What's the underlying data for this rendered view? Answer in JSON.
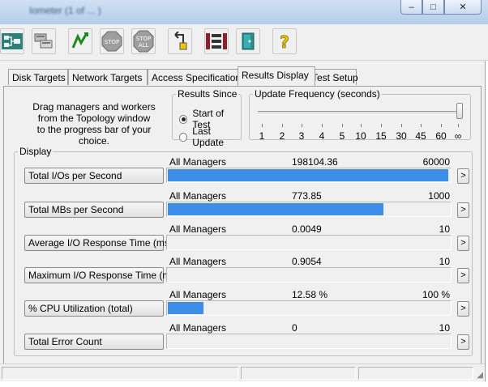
{
  "window": {
    "title": "Iometer (1 of ... )",
    "minimize_glyph": "–",
    "maximize_glyph": "□",
    "close_glyph": "✕"
  },
  "toolbar": {
    "buttons": [
      {
        "icon": "topology-icon"
      },
      {
        "icon": "config-icon"
      },
      {
        "icon": "start-tests-icon"
      },
      {
        "icon": "stop-icon",
        "label": "STOP"
      },
      {
        "icon": "stop-all-icon",
        "label": "STOP ALL"
      },
      {
        "icon": "reset-workers-icon"
      },
      {
        "icon": "new-worker-icon"
      },
      {
        "icon": "exit-icon"
      },
      {
        "icon": "help-icon",
        "label": "?"
      }
    ]
  },
  "tabs": [
    {
      "label": "Disk Targets"
    },
    {
      "label": "Network Targets"
    },
    {
      "label": "Access Specifications"
    },
    {
      "label": "Results Display",
      "active": true
    },
    {
      "label": "Test Setup"
    }
  ],
  "instructions": {
    "line1": "Drag managers and workers",
    "line2": "from the Topology window",
    "line3": "to the progress bar of your choice."
  },
  "results_since": {
    "legend": "Results Since",
    "options": [
      {
        "label": "Start of Test",
        "selected": true
      },
      {
        "label": "Last Update",
        "selected": false
      }
    ]
  },
  "update_frequency": {
    "legend": "Update Frequency (seconds)",
    "ticks": [
      "1",
      "2",
      "3",
      "4",
      "5",
      "10",
      "15",
      "30",
      "45",
      "60",
      "∞"
    ],
    "selected": "∞"
  },
  "display": {
    "legend": "Display",
    "metrics": [
      {
        "label": "Total I/Os per Second",
        "source": "All Managers",
        "value": "198104.36",
        "max": "60000",
        "fill": 1.0
      },
      {
        "label": "Total MBs per Second",
        "source": "All Managers",
        "value": "773.85",
        "max": "1000",
        "fill": 0.77
      },
      {
        "label": "Average I/O Response Time (ms)",
        "source": "All Managers",
        "value": "0.0049",
        "max": "10",
        "fill": 0.0
      },
      {
        "label": "Maximum I/O Response Time (ms)",
        "source": "All Managers",
        "value": "0.9054",
        "max": "10",
        "fill": 0.0
      },
      {
        "label": "% CPU Utilization (total)",
        "source": "All Managers",
        "value": "12.58 %",
        "max": "100 %",
        "fill": 0.1258
      },
      {
        "label": "Total Error Count",
        "source": "All Managers",
        "value": "0",
        "max": "10",
        "fill": 0.0
      }
    ],
    "arrow_glyph": ">"
  },
  "colors": {
    "bar_fill": "#3d8ee8",
    "panel": "#f0f0f0"
  }
}
